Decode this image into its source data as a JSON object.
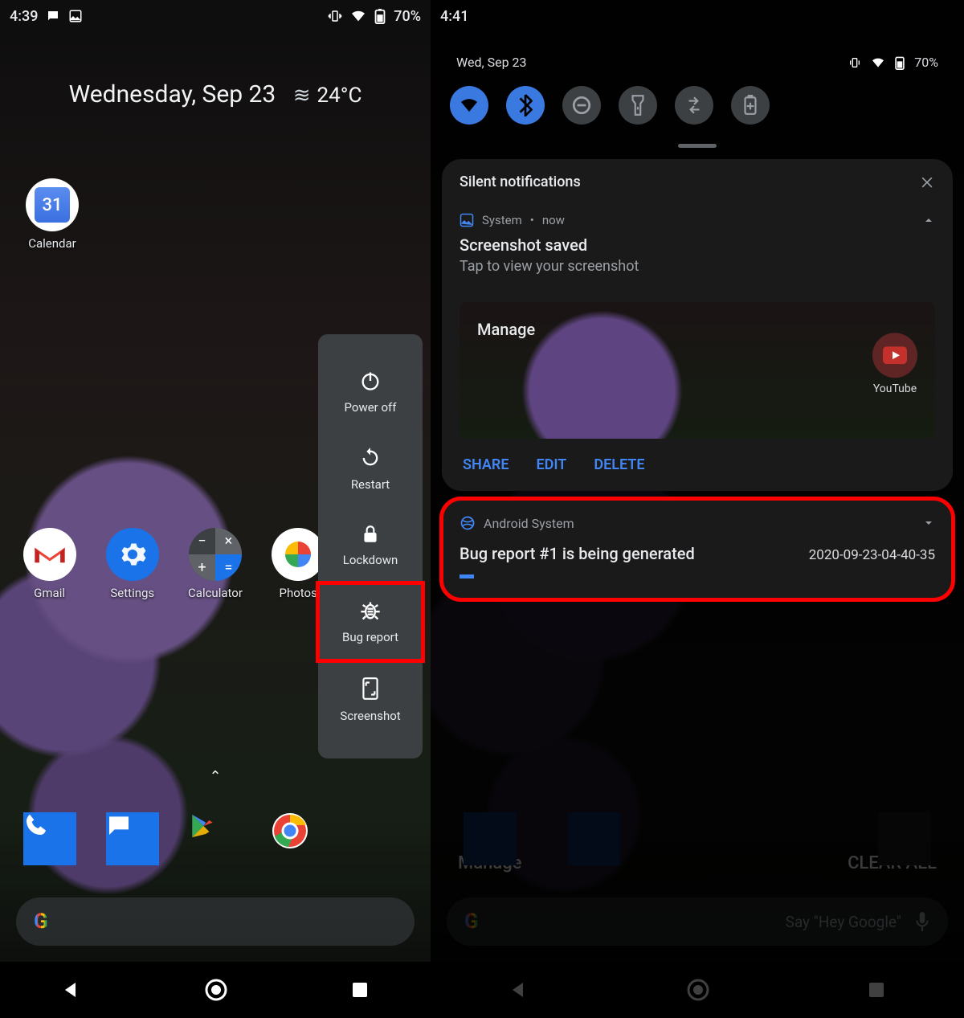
{
  "left": {
    "time": "4:39",
    "battery": "70%",
    "date_line": "Wednesday, Sep 23",
    "temp": "24°C",
    "apps": {
      "calendar_day": "31",
      "calendar_label": "Calendar",
      "gmail": "Gmail",
      "settings": "Settings",
      "calculator": "Calculator",
      "photos": "Photos"
    },
    "power_menu": {
      "power_off": "Power off",
      "restart": "Restart",
      "lockdown": "Lockdown",
      "bug_report": "Bug report",
      "screenshot": "Screenshot"
    }
  },
  "right": {
    "time": "4:41",
    "battery": "70%",
    "date_short": "Wed, Sep 23",
    "silent_header": "Silent notifications",
    "screenshot_notif": {
      "app": "System",
      "when": "now",
      "title": "Screenshot saved",
      "body": "Tap to view your screenshot",
      "thumb_label": "Manage",
      "yt_label": "YouTube",
      "action_share": "SHARE",
      "action_edit": "EDIT",
      "action_delete": "DELETE"
    },
    "bug_notif": {
      "app": "Android System",
      "title": "Bug report #1 is being generated",
      "timestamp": "2020-09-23-04-40-35"
    },
    "footer": {
      "manage": "Manage",
      "clear": "CLEAR ALL",
      "hint": "Say \"Hey Google\""
    }
  }
}
